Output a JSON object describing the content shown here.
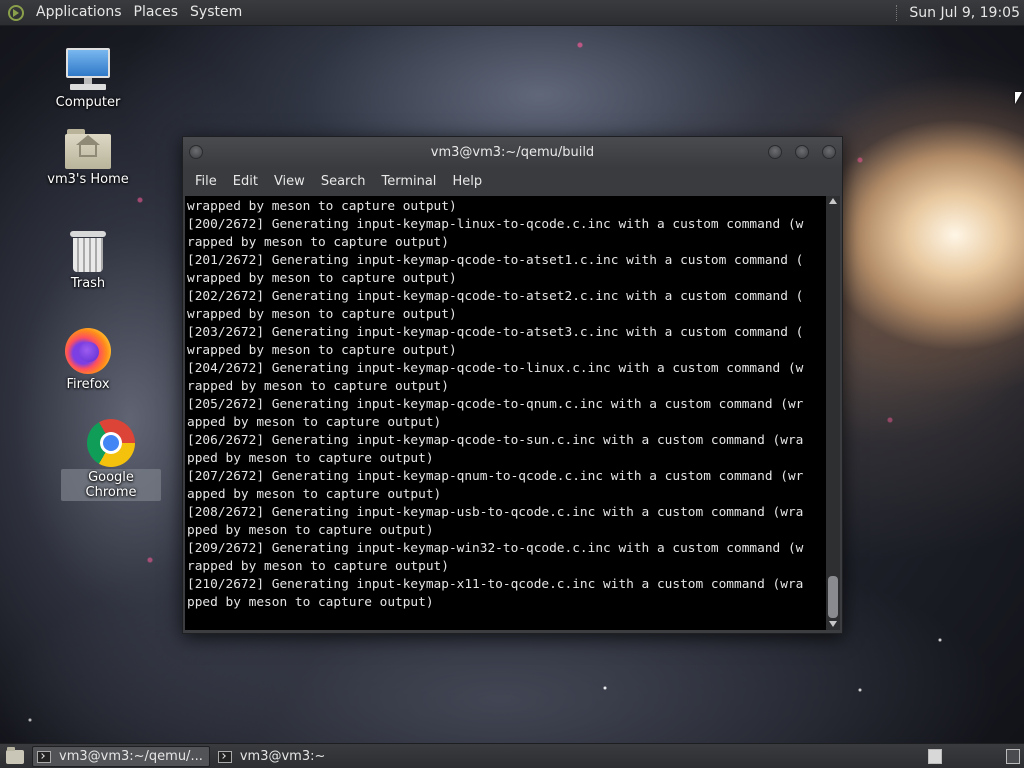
{
  "top_panel": {
    "menus": [
      "Applications",
      "Places",
      "System"
    ],
    "clock": "Sun Jul  9, 19:05"
  },
  "desktop_icons": [
    {
      "label": "Computer",
      "icon": "computer-icon"
    },
    {
      "label": "vm3's Home",
      "icon": "home-folder-icon"
    },
    {
      "label": "Trash",
      "icon": "trash-icon"
    },
    {
      "label": "Firefox",
      "icon": "firefox-icon"
    },
    {
      "label": "Google Chrome",
      "icon": "chrome-icon",
      "selected": true
    }
  ],
  "terminal": {
    "title": "vm3@vm3:~/qemu/build",
    "menu": [
      "File",
      "Edit",
      "View",
      "Search",
      "Terminal",
      "Help"
    ],
    "lines": [
      "wrapped by meson to capture output)",
      "[200/2672] Generating input-keymap-linux-to-qcode.c.inc with a custom command (w",
      "rapped by meson to capture output)",
      "[201/2672] Generating input-keymap-qcode-to-atset1.c.inc with a custom command (",
      "wrapped by meson to capture output)",
      "[202/2672] Generating input-keymap-qcode-to-atset2.c.inc with a custom command (",
      "wrapped by meson to capture output)",
      "[203/2672] Generating input-keymap-qcode-to-atset3.c.inc with a custom command (",
      "wrapped by meson to capture output)",
      "[204/2672] Generating input-keymap-qcode-to-linux.c.inc with a custom command (w",
      "rapped by meson to capture output)",
      "[205/2672] Generating input-keymap-qcode-to-qnum.c.inc with a custom command (wr",
      "apped by meson to capture output)",
      "[206/2672] Generating input-keymap-qcode-to-sun.c.inc with a custom command (wra",
      "pped by meson to capture output)",
      "[207/2672] Generating input-keymap-qnum-to-qcode.c.inc with a custom command (wr",
      "apped by meson to capture output)",
      "[208/2672] Generating input-keymap-usb-to-qcode.c.inc with a custom command (wra",
      "pped by meson to capture output)",
      "[209/2672] Generating input-keymap-win32-to-qcode.c.inc with a custom command (w",
      "rapped by meson to capture output)",
      "[210/2672] Generating input-keymap-x11-to-qcode.c.inc with a custom command (wra",
      "pped by meson to capture output)"
    ]
  },
  "taskbar": {
    "tasks": [
      {
        "label": "vm3@vm3:~/qemu/...",
        "active": true
      },
      {
        "label": "vm3@vm3:~",
        "active": false
      }
    ]
  },
  "colors": {
    "panel_bg": "#2c2d30",
    "terminal_bg": "#000000",
    "terminal_fg": "#e5e5e5"
  }
}
